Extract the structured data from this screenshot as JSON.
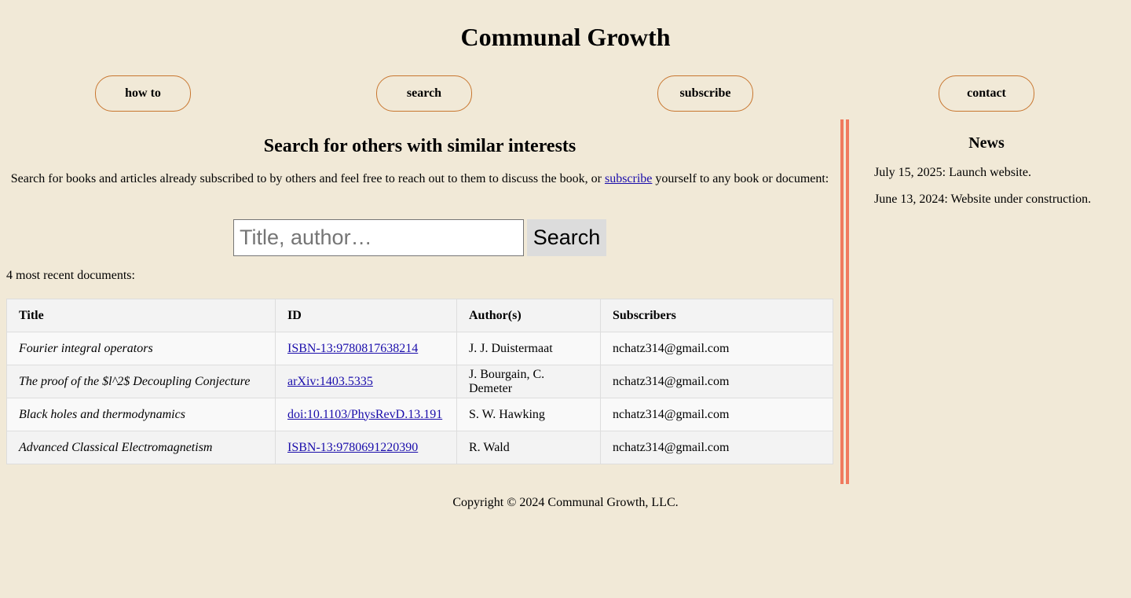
{
  "site": {
    "title": "Communal Growth"
  },
  "nav": {
    "how_to": "how to",
    "search": "search",
    "subscribe": "subscribe",
    "contact": "contact"
  },
  "main": {
    "heading": "Search for others with similar interests",
    "intro_before": "Search for books and articles already subscribed to by others and feel free to reach out to them to discuss the book, or ",
    "intro_link": "subscribe",
    "intro_after": " yourself to any book or document:",
    "search": {
      "placeholder": "Title, author…",
      "value": "",
      "button_label": "Search"
    },
    "recent_label": "4 most recent documents:",
    "table": {
      "headers": [
        "Title",
        "ID",
        "Author(s)",
        "Subscribers"
      ],
      "rows": [
        {
          "title": "Fourier integral operators",
          "id": "ISBN-13:9780817638214",
          "authors": "J. J. Duistermaat",
          "subscribers": "nchatz314@gmail.com"
        },
        {
          "title": "The proof of the $l^2$ Decoupling Conjecture",
          "id": "arXiv:1403.5335",
          "authors": "J. Bourgain, C. Demeter",
          "subscribers": "nchatz314@gmail.com"
        },
        {
          "title": "Black holes and thermodynamics",
          "id": "doi:10.1103/PhysRevD.13.191",
          "authors": "S. W. Hawking",
          "subscribers": "nchatz314@gmail.com"
        },
        {
          "title": "Advanced Classical Electromagnetism",
          "id": "ISBN-13:9780691220390",
          "authors": "R. Wald",
          "subscribers": "nchatz314@gmail.com"
        }
      ]
    }
  },
  "news": {
    "heading": "News",
    "items": [
      "July 15, 2025: Launch website.",
      "June 13, 2024: Website under construction."
    ]
  },
  "footer": {
    "copyright": "Copyright © 2024 Communal Growth, LLC."
  },
  "colors": {
    "background": "#f1e9d7",
    "nav_border": "#c8762f",
    "divider": "#f07a5e",
    "link": "#1a0dab"
  }
}
